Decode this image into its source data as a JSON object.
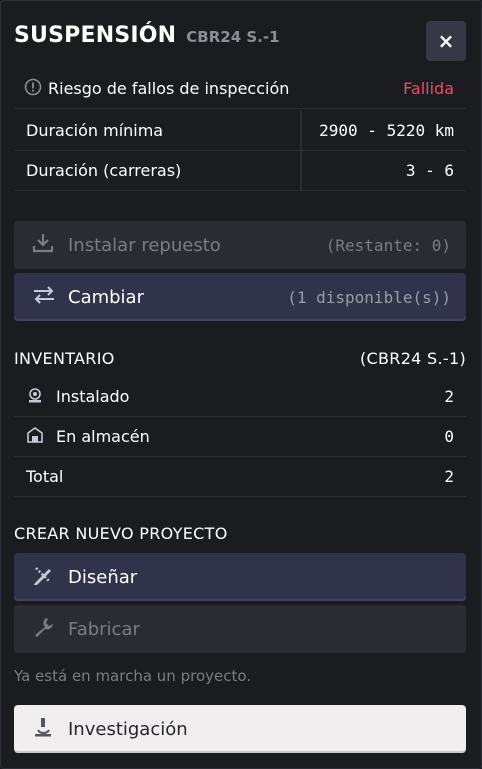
{
  "header": {
    "title": "SUSPENSIÓN",
    "subtitle": "CBR24 S.-1",
    "close_label": "×"
  },
  "risk": {
    "label": "Riesgo de fallos de inspección",
    "value": "Fallida",
    "value_color": "#ee4b68"
  },
  "specs": [
    {
      "label": "Duración mínima",
      "value": "2900 - 5220 km"
    },
    {
      "label": "Duración (carreras)",
      "value": "3 - 6"
    }
  ],
  "actions": {
    "install": {
      "label": "Instalar repuesto",
      "extra": "(Restante: 0)"
    },
    "swap": {
      "label": "Cambiar",
      "extra": "(1 disponible(s))"
    }
  },
  "inventory": {
    "title": "INVENTARIO",
    "part": "(CBR24 S.-1)",
    "rows": [
      {
        "label": "Instalado",
        "value": "2"
      },
      {
        "label": "En almacén",
        "value": "0"
      },
      {
        "label": "Total",
        "value": "2"
      }
    ]
  },
  "project": {
    "title": "CREAR NUEVO PROYECTO",
    "design_label": "Diseñar",
    "build_label": "Fabricar",
    "note": "Ya está en marcha un proyecto.",
    "research_label": "Investigación"
  },
  "icons": {
    "risk": "alert-circle-icon",
    "install": "download-icon",
    "swap": "swap-arrows-icon",
    "installed": "car-parts-icon",
    "storage": "warehouse-icon",
    "design": "pencil-ruler-icon",
    "build": "wrench-icon",
    "research": "microscope-icon"
  }
}
